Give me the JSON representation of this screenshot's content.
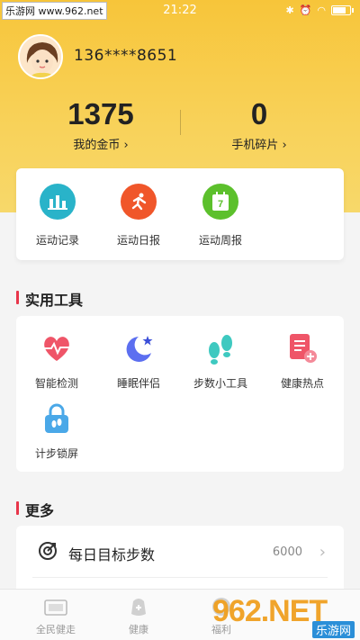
{
  "watermark": {
    "top_left": "乐游网 www.962.net",
    "bottom_logo": "962.NET",
    "bottom_sub": "乐游网"
  },
  "status_bar": {
    "time": "21:22"
  },
  "profile": {
    "phone": "136****8651"
  },
  "stats": [
    {
      "value": "1375",
      "label": "我的金币 ›"
    },
    {
      "value": "0",
      "label": "手机碎片 ›"
    }
  ],
  "sport": [
    {
      "label": "运动记录",
      "icon": "bar-chart-icon",
      "color": "#29b3c9"
    },
    {
      "label": "运动日报",
      "icon": "runner-icon",
      "color": "#f0562a"
    },
    {
      "label": "运动周报",
      "icon": "calendar-7-icon",
      "color": "#5cc02c",
      "badge": "7"
    }
  ],
  "tools_section": {
    "title": "实用工具"
  },
  "tools": [
    {
      "label": "智能检测",
      "icon": "heart-pulse-icon"
    },
    {
      "label": "睡眠伴侣",
      "icon": "moon-star-icon"
    },
    {
      "label": "步数小工具",
      "icon": "footprints-icon"
    },
    {
      "label": "健康热点",
      "icon": "health-doc-icon"
    },
    {
      "label": "计步锁屏",
      "icon": "lock-footprint-icon"
    }
  ],
  "more_section": {
    "title": "更多"
  },
  "more": [
    {
      "label": "每日目标步数",
      "value": "6000",
      "icon": "target-icon"
    }
  ],
  "tabbar": [
    {
      "label": "全民健走",
      "icon": "walk-tab-icon"
    },
    {
      "label": "健康",
      "icon": "health-bag-icon"
    },
    {
      "label": "福利",
      "icon": "gift-tab-icon"
    },
    {
      "label": "",
      "icon": "me-tab-icon"
    }
  ],
  "colors": {
    "accent_red": "#e8364a",
    "header_yellow": "#f7c53a"
  }
}
